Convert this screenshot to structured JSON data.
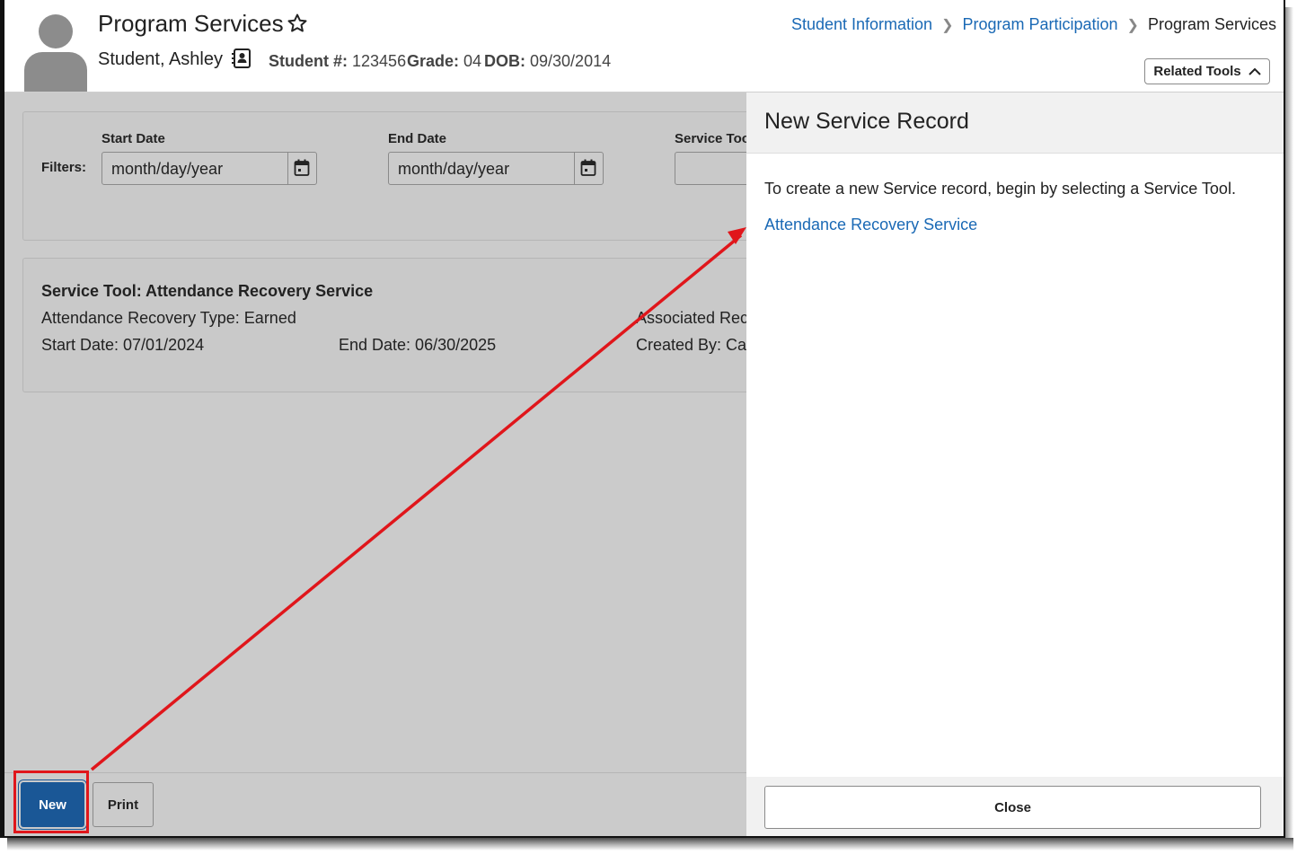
{
  "header": {
    "page_title": "Program Services",
    "student_name": "Student, Ashley",
    "student_num_label": "Student #:",
    "student_num": "123456",
    "grade_label": "Grade:",
    "grade": "04",
    "dob_label": "DOB:",
    "dob": "09/30/2014",
    "related_tools_label": "Related Tools"
  },
  "breadcrumb": [
    "Student Information",
    "Program Participation",
    "Program Services"
  ],
  "filters": {
    "label": "Filters:",
    "start_date_label": "Start Date",
    "start_date_value": "month/day/year",
    "end_date_label": "End Date",
    "end_date_value": "month/day/year",
    "service_tool_label": "Service Tool"
  },
  "record": {
    "title": "Service Tool: Attendance Recovery Service",
    "type": "Attendance Recovery Type: Earned",
    "associated": "Associated Reco",
    "start": "Start Date: 07/01/2024",
    "end": "End Date: 06/30/2025",
    "created_by": "Created By: Cala"
  },
  "footer": {
    "new_label": "New",
    "print_label": "Print"
  },
  "panel": {
    "title": "New Service Record",
    "intro": "To create a new Service record, begin by selecting a Service Tool.",
    "link": "Attendance Recovery Service",
    "close_label": "Close"
  },
  "colors": {
    "link": "#1a69b5",
    "primary": "#1a5796",
    "annotation": "#e0161b"
  }
}
